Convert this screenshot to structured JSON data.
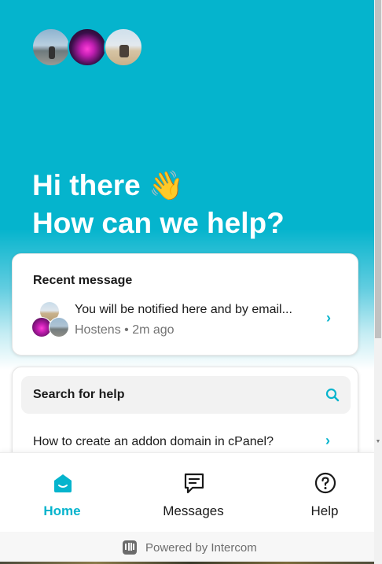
{
  "header": {
    "greeting_line1": "Hi there",
    "wave_emoji": "👋",
    "greeting_line2": "How can we help?",
    "avatar_count": 3,
    "accent_color": "#05b4cd"
  },
  "recent_message": {
    "title": "Recent message",
    "preview": "You will be notified here and by email...",
    "meta": "Hostens • 2m ago",
    "chevron": "›"
  },
  "help": {
    "search_label": "Search for help",
    "search_icon": "search-icon",
    "articles": [
      {
        "title": "How to create an addon domain in cPanel?"
      }
    ],
    "chevron": "›"
  },
  "nav": {
    "items": [
      {
        "label": "Home",
        "icon": "home-icon",
        "active": true
      },
      {
        "label": "Messages",
        "icon": "messages-icon",
        "active": false
      },
      {
        "label": "Help",
        "icon": "help-icon",
        "active": false
      }
    ]
  },
  "footer": {
    "powered_text": "Powered by Intercom",
    "logo": "intercom-logo-icon"
  }
}
